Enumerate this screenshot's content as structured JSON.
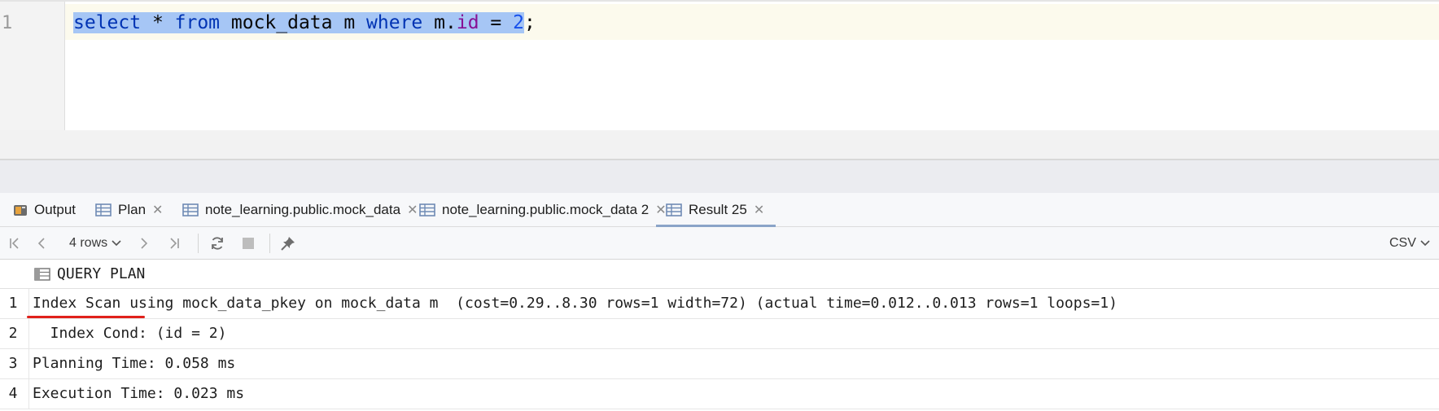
{
  "editor": {
    "line_number": "1",
    "tokens": {
      "select": "select",
      "star": " * ",
      "from": "from",
      "table": " mock_data m ",
      "where": "where",
      "alias": " m.",
      "id": "id",
      "eq": " = ",
      "value": "2",
      "semicolon": ";"
    }
  },
  "tabs": [
    {
      "label": "Output",
      "icon": "output-icon",
      "closable": false
    },
    {
      "label": "Plan",
      "icon": "table-icon",
      "closable": true
    },
    {
      "label": "note_learning.public.mock_data",
      "icon": "table-icon",
      "closable": true
    },
    {
      "label": "note_learning.public.mock_data 2",
      "icon": "table-icon",
      "closable": true
    },
    {
      "label": "Result 25",
      "icon": "table-icon",
      "closable": true,
      "active": true
    }
  ],
  "tab_close_glyph": "✕",
  "toolbar": {
    "rows_label": "4 rows",
    "export_label": "CSV"
  },
  "grid": {
    "column_header": "QUERY PLAN",
    "rows": [
      {
        "num": "1",
        "value": "Index Scan using mock_data_pkey on mock_data m  (cost=0.29..8.30 rows=1 width=72) (actual time=0.012..0.013 rows=1 loops=1)"
      },
      {
        "num": "2",
        "value": "  Index Cond: (id = 2)"
      },
      {
        "num": "3",
        "value": "Planning Time: 0.058 ms"
      },
      {
        "num": "4",
        "value": "Execution Time: 0.023 ms"
      }
    ]
  },
  "colors": {
    "keyword": "#0033b3",
    "column": "#871094",
    "number": "#1750eb",
    "selection": "#a6c6f5",
    "underline": "#e0201a"
  }
}
